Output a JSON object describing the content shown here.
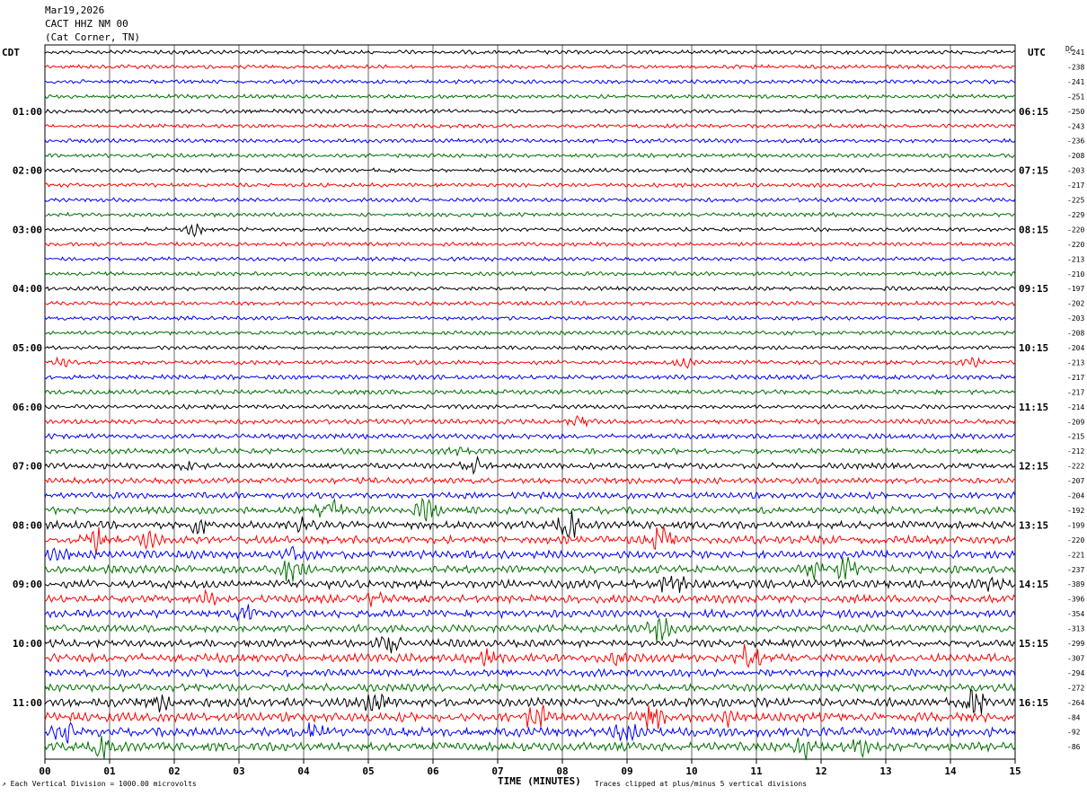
{
  "header": {
    "date": "Mar19,2026",
    "station": "CACT HHZ NM 00",
    "location": "(Cat Corner, TN)"
  },
  "left_label": "CDT",
  "right_label": "UTC",
  "dc_header": "DC",
  "footer": {
    "scale_note": "Each Vertical Division = 1000.00 microvolts",
    "clip_note": "Traces clipped at plus/minus 5 vertical divisions"
  },
  "chart_data": {
    "type": "helicorder",
    "xlabel": "TIME (MINUTES)",
    "x_ticks": [
      "00",
      "01",
      "02",
      "03",
      "04",
      "05",
      "06",
      "07",
      "08",
      "09",
      "10",
      "11",
      "12",
      "13",
      "14",
      "15"
    ],
    "xlim": [
      0,
      15
    ],
    "trace_colors": [
      "#000000",
      "#ff0000",
      "#0000ff",
      "#007000"
    ],
    "left_times": [
      "01:00",
      "02:00",
      "03:00",
      "04:00",
      "05:00",
      "06:00",
      "07:00",
      "08:00",
      "09:00",
      "10:00",
      "11:00"
    ],
    "right_times": [
      "06:15",
      "07:15",
      "08:15",
      "09:15",
      "10:15",
      "11:15",
      "12:15",
      "13:15",
      "14:15",
      "15:15",
      "16:15"
    ],
    "dc_offsets": [
      -241,
      -238,
      -241,
      -251,
      -250,
      -243,
      -236,
      -208,
      -203,
      -217,
      -225,
      -229,
      -220,
      -220,
      -213,
      -210,
      -197,
      -202,
      -203,
      -208,
      -204,
      -213,
      -217,
      -217,
      -214,
      -209,
      -215,
      -212,
      -222,
      -207,
      -204,
      -192,
      -199,
      -220,
      -221,
      -237,
      -389,
      -396,
      -354,
      -313,
      -299,
      -307,
      -294,
      -272,
      -264,
      -84,
      -92,
      -86
    ],
    "activity": [
      1,
      1,
      1,
      1,
      1,
      1,
      1,
      1,
      1,
      1,
      1,
      1,
      1,
      1,
      1,
      1,
      1,
      1,
      1,
      1,
      1,
      1.1,
      1.2,
      1.2,
      1.1,
      1.2,
      1.3,
      1.4,
      1.5,
      1.5,
      1.6,
      1.8,
      1.9,
      2.0,
      2.0,
      2.0,
      2.1,
      2.0,
      2.0,
      1.9,
      1.9,
      2.2,
      1.9,
      1.9,
      2.2,
      2.3,
      2.3,
      2.2
    ],
    "bursts": [
      {
        "row": 12,
        "minute": 2.3,
        "amp": 5
      },
      {
        "row": 21,
        "minute": 0.2,
        "amp": 5
      },
      {
        "row": 21,
        "minute": 9.9,
        "amp": 5
      },
      {
        "row": 21,
        "minute": 14.3,
        "amp": 4
      },
      {
        "row": 25,
        "minute": 8.3,
        "amp": 6
      },
      {
        "row": 27,
        "minute": 6.4,
        "amp": 5
      },
      {
        "row": 28,
        "minute": 6.6,
        "amp": 10
      },
      {
        "row": 28,
        "minute": 2.2,
        "amp": 5
      },
      {
        "row": 31,
        "minute": 4.4,
        "amp": 12
      },
      {
        "row": 31,
        "minute": 5.9,
        "amp": 10
      },
      {
        "row": 32,
        "minute": 2.4,
        "amp": 14
      },
      {
        "row": 32,
        "minute": 8.1,
        "amp": 14
      },
      {
        "row": 32,
        "minute": 4.0,
        "amp": 6
      },
      {
        "row": 33,
        "minute": 0.8,
        "amp": 14
      },
      {
        "row": 33,
        "minute": 9.5,
        "amp": 14
      },
      {
        "row": 33,
        "minute": 1.6,
        "amp": 7
      },
      {
        "row": 34,
        "minute": 0.2,
        "amp": 6
      },
      {
        "row": 34,
        "minute": 3.9,
        "amp": 8
      },
      {
        "row": 35,
        "minute": 3.8,
        "amp": 14
      },
      {
        "row": 35,
        "minute": 12.4,
        "amp": 12
      },
      {
        "row": 35,
        "minute": 11.9,
        "amp": 8
      },
      {
        "row": 36,
        "minute": 9.7,
        "amp": 14
      },
      {
        "row": 36,
        "minute": 14.6,
        "amp": 8
      },
      {
        "row": 37,
        "minute": 2.5,
        "amp": 5
      },
      {
        "row": 37,
        "minute": 5.1,
        "amp": 6
      },
      {
        "row": 38,
        "minute": 3.1,
        "amp": 10
      },
      {
        "row": 39,
        "minute": 9.5,
        "amp": 12
      },
      {
        "row": 40,
        "minute": 5.3,
        "amp": 12
      },
      {
        "row": 41,
        "minute": 10.9,
        "amp": 14
      },
      {
        "row": 41,
        "minute": 8.8,
        "amp": 7
      },
      {
        "row": 41,
        "minute": 6.8,
        "amp": 6
      },
      {
        "row": 44,
        "minute": 5.1,
        "amp": 14
      },
      {
        "row": 44,
        "minute": 14.4,
        "amp": 14
      },
      {
        "row": 44,
        "minute": 1.8,
        "amp": 7
      },
      {
        "row": 45,
        "minute": 7.6,
        "amp": 14
      },
      {
        "row": 45,
        "minute": 9.4,
        "amp": 14
      },
      {
        "row": 45,
        "minute": 10.6,
        "amp": 7
      },
      {
        "row": 46,
        "minute": 4.2,
        "amp": 12
      },
      {
        "row": 46,
        "minute": 0.3,
        "amp": 9
      },
      {
        "row": 46,
        "minute": 9.0,
        "amp": 10
      },
      {
        "row": 47,
        "minute": 0.9,
        "amp": 10
      },
      {
        "row": 47,
        "minute": 11.7,
        "amp": 14
      },
      {
        "row": 47,
        "minute": 12.6,
        "amp": 7
      }
    ]
  }
}
